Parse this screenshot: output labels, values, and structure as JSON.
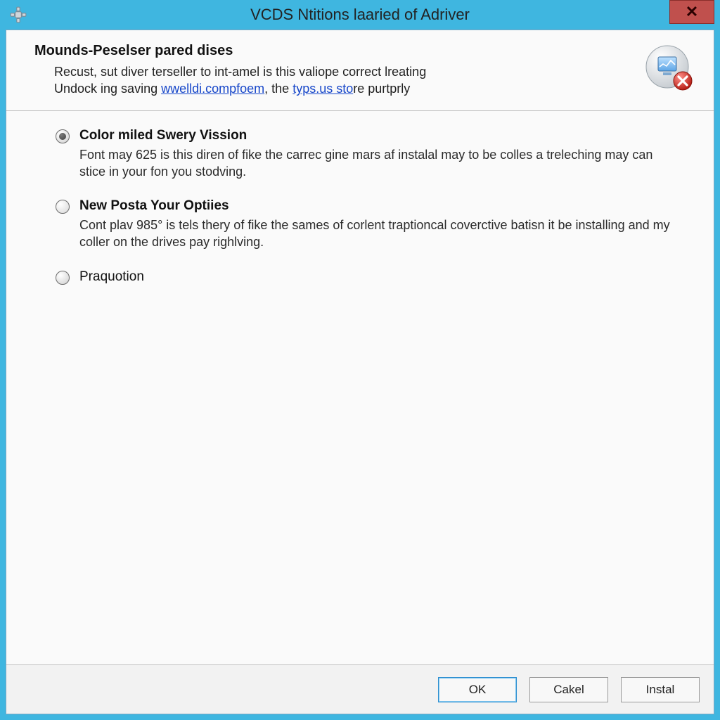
{
  "window": {
    "title": "VCDS Ntitions laaried of Adriver"
  },
  "header": {
    "title": "Mounds-Peselser pared dises",
    "line1_a": "Recust, sut diver terseller to int-amel is this valiope correct lreating",
    "line2_a": "Undock ing saving ",
    "line2_link1": "wwelldi.compfoem",
    "line2_b": ", the ",
    "line2_link2": "typs.us sto",
    "line2_c": "re purtprly"
  },
  "options": [
    {
      "id": "opt-color",
      "title": "Color miled Swery Vission",
      "desc": "Font may 625 is this diren of fike the carrec gine mars af instalal may to be colles a treleching may can stice in your fon you stodving.",
      "selected": true
    },
    {
      "id": "opt-posta",
      "title": "New Posta Your Optiies",
      "desc": "Cont plav 985° is tels thery of fike the sames of corlent traptioncal coverctive batisn it be installing and my coller on the drives pay righlving.",
      "selected": false
    },
    {
      "id": "opt-prod",
      "title": "Praquotion",
      "desc": "",
      "selected": false
    }
  ],
  "buttons": {
    "ok": "OK",
    "cancel": "Cakel",
    "install": "Instal"
  },
  "icons": {
    "close": "✕"
  }
}
